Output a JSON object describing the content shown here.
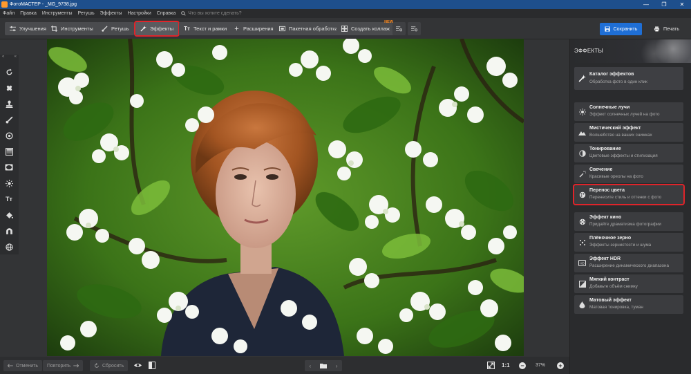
{
  "titlebar": {
    "title": "ФотоМАСТЕР - _MG_9738.jpg",
    "controls": [
      "—",
      "❐",
      "✕"
    ]
  },
  "menu": {
    "items": [
      "Файл",
      "Правка",
      "Инструменты",
      "Ретушь",
      "Эффекты",
      "Настройки",
      "Справка"
    ],
    "search_placeholder": "Что вы хотите сделать?"
  },
  "toolbar": {
    "improvements": "Улучшения",
    "tools": "Инструменты",
    "retouch": "Ретушь",
    "effects": "Эффекты",
    "text_frames": "Текст и рамки",
    "extensions": "Расширения",
    "batch": "Пакетная обработка",
    "collage": "Создать коллаж",
    "collage_badge": "NEW",
    "save": "Сохранить",
    "print": "Печать"
  },
  "bottom": {
    "undo": "Отменить",
    "redo": "Повторить",
    "reset": "Сбросить",
    "zoom_ratio": "1:1",
    "zoom_value": "37%"
  },
  "panel": {
    "title": "ЭФФЕКТЫ",
    "catalog": {
      "title": "Каталог эффектов",
      "subtitle": "Обработка фото в один клик",
      "icon": "magic-wand-icon"
    },
    "items": [
      {
        "title": "Солнечные лучи",
        "subtitle": "Эффект солнечных лучей на фото",
        "icon": "sun-icon"
      },
      {
        "title": "Мистический эффект",
        "subtitle": "Волшебство на ваших снимках",
        "icon": "mountains-icon"
      },
      {
        "title": "Тонирование",
        "subtitle": "Цветовые эффекты и стилизация",
        "icon": "half-circle-icon"
      },
      {
        "title": "Свечение",
        "subtitle": "Красивые ореолы на фото",
        "icon": "glow-wand-icon"
      },
      {
        "title": "Перенос цвета",
        "subtitle": "Перенесите стиль и оттенки с фото",
        "icon": "palette-icon",
        "selected": true
      },
      {
        "title": "Эффект кино",
        "subtitle": "Придайте драматизма фотографии",
        "icon": "film-reel-icon"
      },
      {
        "title": "Плёночное зерно",
        "subtitle": "Эффекты зернистости и шума",
        "icon": "grain-icon"
      },
      {
        "title": "Эффект HDR",
        "subtitle": "Расширение динамического диапазона",
        "icon": "hdr-icon"
      },
      {
        "title": "Мягкий контраст",
        "subtitle": "Добавьте объём снимку",
        "icon": "contrast-icon"
      },
      {
        "title": "Матовый эффект",
        "subtitle": "Матовая тонировка, туман",
        "icon": "drop-icon"
      }
    ]
  },
  "colors": {
    "accent": "#1f6fd6",
    "highlight": "#e0242a",
    "titlebar": "#1e4f8c"
  }
}
